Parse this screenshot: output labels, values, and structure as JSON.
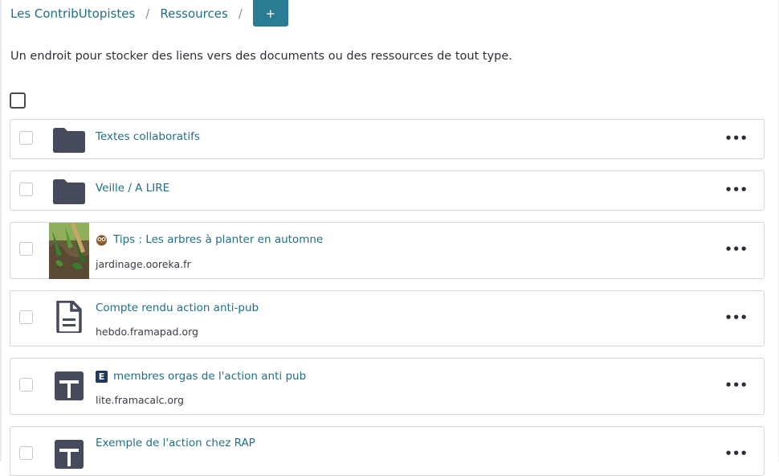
{
  "breadcrumb": {
    "items": [
      "Les ContribUtopistes",
      "Ressources"
    ],
    "separator": "/",
    "add_label": "+"
  },
  "description": "Un endroit pour stocker des liens vers des documents ou des ressources de tout type.",
  "resources": [
    {
      "title": "Textes collaboratifs",
      "subtitle": "",
      "icon": "folder-icon"
    },
    {
      "title": "Veille / A LIRE",
      "subtitle": "",
      "icon": "folder-icon"
    },
    {
      "title": "Tips : Les arbres à planter en automne",
      "subtitle": "jardinage.ooreka.fr",
      "icon": "garden-thumbnail",
      "favicon": "owl-icon"
    },
    {
      "title": "Compte rendu action anti-pub",
      "subtitle": "hebdo.framapad.org",
      "icon": "document-icon"
    },
    {
      "title": "membres orgas de l'action anti pub",
      "subtitle": "lite.framacalc.org",
      "icon": "spreadsheet-icon",
      "favicon": "letter-e-icon",
      "favicon_letter": "E"
    },
    {
      "title": "Exemple de l'action chez RAP",
      "subtitle": "",
      "icon": "spreadsheet-icon"
    }
  ],
  "more_label": "•••",
  "colors": {
    "accent": "#2a7c93",
    "link": "#1f6f86",
    "icon": "#454a5c"
  }
}
